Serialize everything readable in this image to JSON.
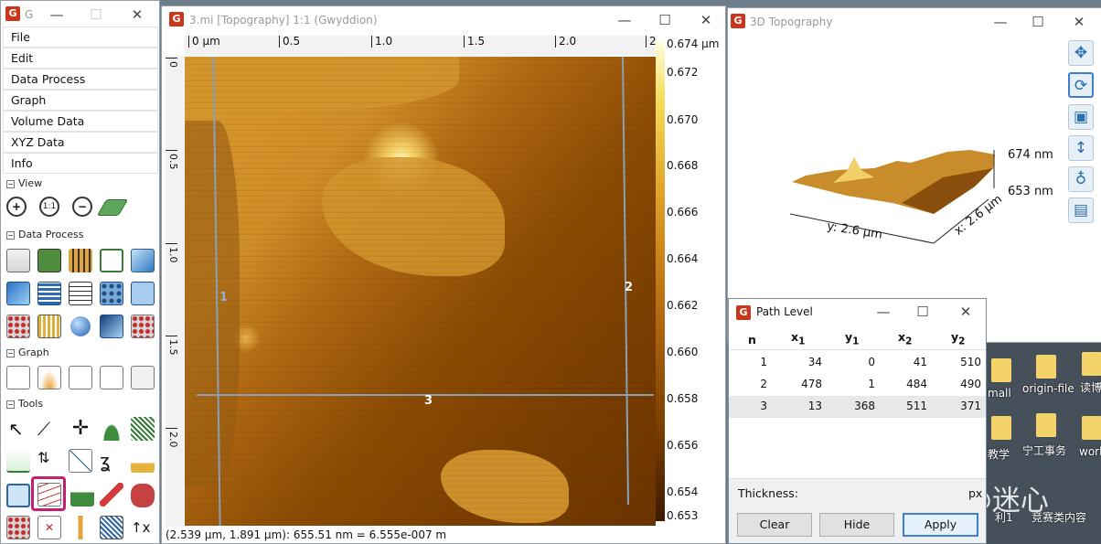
{
  "toolbox": {
    "title": "G",
    "menu": [
      "File",
      "Edit",
      "Data Process",
      "Graph",
      "Volume Data",
      "XYZ Data",
      "Info"
    ],
    "sections": {
      "view": "View",
      "data_process": "Data Process",
      "graph": "Graph",
      "tools": "Tools"
    },
    "zoom_label": "1:1"
  },
  "image_window": {
    "title": "3.mi [Topography] 1:1 (Gwyddion)",
    "h_ruler": [
      "0 µm",
      "0.5",
      "1.0",
      "1.5",
      "2.0",
      "2"
    ],
    "v_ruler": [
      "0",
      "0.5",
      "1.0",
      "1.5",
      "2.0"
    ],
    "colorbar": [
      "0.674 µm",
      "0.672",
      "0.670",
      "0.668",
      "0.666",
      "0.664",
      "0.662",
      "0.660",
      "0.658",
      "0.656",
      "0.654",
      "0.653"
    ],
    "profile_labels": [
      "1",
      "2",
      "3"
    ],
    "status": "(2.539 µm, 1.891 µm): 655.51 nm = 6.555e-007 m"
  },
  "view3d": {
    "title": "3D Topography",
    "z_max": "674 nm",
    "z_min": "653 nm",
    "x_axis": "x: 2.6 µm",
    "y_axis": "y: 2.6 µm"
  },
  "path_level": {
    "title": "Path Level",
    "headers": {
      "n": "n",
      "x1": "x",
      "x1_sub": "1",
      "y1": "y",
      "y1_sub": "1",
      "x2": "x",
      "x2_sub": "2",
      "y2": "y",
      "y2_sub": "2"
    },
    "rows": [
      {
        "n": "1",
        "x1": "34",
        "y1": "0",
        "x2": "41",
        "y2": "510"
      },
      {
        "n": "2",
        "x1": "478",
        "y1": "1",
        "x2": "484",
        "y2": "490"
      },
      {
        "n": "3",
        "x1": "13",
        "y1": "368",
        "x2": "511",
        "y2": "371"
      }
    ],
    "thickness_label": "Thickness:",
    "thickness_unit": "px",
    "buttons": {
      "clear": "Clear",
      "hide": "Hide",
      "apply": "Apply"
    }
  },
  "desktop": {
    "icons": [
      "mall",
      "origin-file",
      "读博",
      "教学",
      "宁工事务",
      "work",
      "利1",
      "竞赛类内容"
    ],
    "watermark": "知乎 @迷心"
  }
}
